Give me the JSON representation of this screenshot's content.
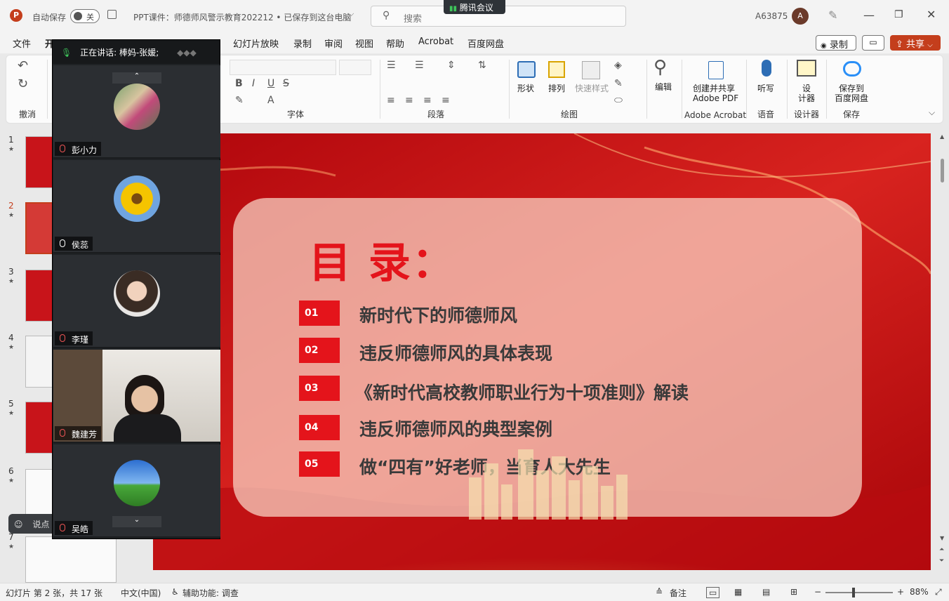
{
  "titlebar": {
    "autosave_label": "自动保存",
    "autosave_state": "关",
    "doc_title": "PPT课件：师德师风警示教育202212 • 已保存到这台电脑",
    "search_placeholder": "搜索",
    "meeting_app": "腾讯会议",
    "user_id": "A63875",
    "user_initial": "A"
  },
  "menu": {
    "items": [
      "文件",
      "开",
      "幻灯片放映",
      "录制",
      "审阅",
      "视图",
      "帮助",
      "Acrobat",
      "百度网盘"
    ],
    "record_button": "录制",
    "share_button": "共享"
  },
  "ribbon": {
    "groups": {
      "undo": "撤消",
      "font": "字体",
      "paragraph": "段落",
      "drawing": "绘图",
      "acrobat": "Adobe Acrobat",
      "voice": "语音",
      "designer": "设计器",
      "save": "保存"
    },
    "buttons": {
      "shape": "形状",
      "arrange": "排列",
      "quick_style": "快速样式",
      "edit": "编辑",
      "create_share_pdf_1": "创建并共享",
      "create_share_pdf_2": "Adobe PDF",
      "dictate": "听写",
      "designer_1": "设",
      "designer_2": "计器",
      "save_baidu_1": "保存到",
      "save_baidu_2": "百度网盘"
    }
  },
  "thumbnails": [
    {
      "num": "1",
      "star": "★"
    },
    {
      "num": "2",
      "star": "★"
    },
    {
      "num": "3",
      "star": "★"
    },
    {
      "num": "4",
      "star": "★"
    },
    {
      "num": "5",
      "star": "★"
    },
    {
      "num": "6",
      "star": "★"
    },
    {
      "num": "7",
      "star": "★"
    }
  ],
  "meeting": {
    "speaking_label": "正在讲话: 棒妈-张媛;",
    "participants": [
      {
        "name": "彭小力",
        "muted": true
      },
      {
        "name": "侯蕊",
        "muted": false
      },
      {
        "name": "李瑾",
        "muted": true
      },
      {
        "name": "魏建芳",
        "muted": true
      },
      {
        "name": "吴皓",
        "muted": true
      }
    ],
    "chat_hint": "说点"
  },
  "slide": {
    "title": "目 录：",
    "items": [
      {
        "num": "01",
        "text": "新时代下的师德师风"
      },
      {
        "num": "02",
        "text": "违反师德师风的具体表现"
      },
      {
        "num": "03",
        "text": "《新时代高校教师职业行为十项准则》解读"
      },
      {
        "num": "04",
        "text": "违反师德师风的典型案例"
      },
      {
        "num": "05",
        "text": "做“四有”好老师，当育人大先生"
      }
    ]
  },
  "statusbar": {
    "slide_info": "幻灯片 第 2 张，共 17 张",
    "language": "中文(中国)",
    "accessibility": "辅助功能: 调查",
    "notes": "备注",
    "zoom": "88%"
  },
  "colors": {
    "accent_red": "#c8141a",
    "share_button": "#c43e1c",
    "meeting_bg": "#1f2225"
  }
}
